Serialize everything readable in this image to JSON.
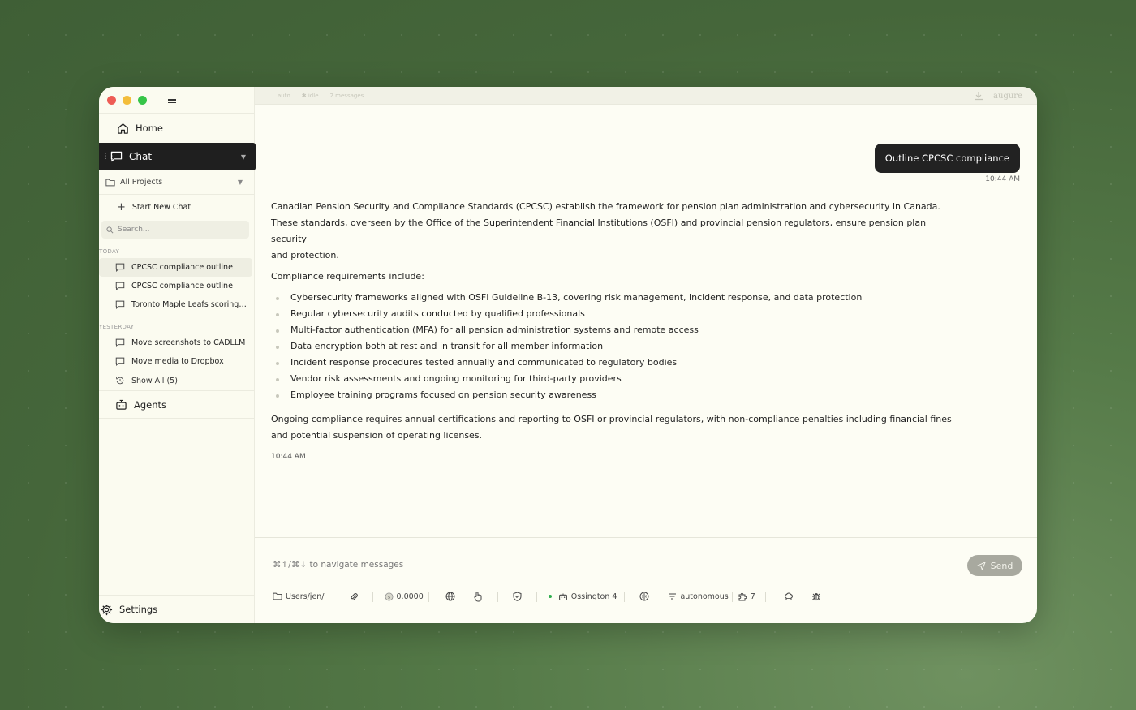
{
  "sidebar": {
    "home_label": "Home",
    "chat_label": "Chat",
    "projects_label": "All Projects",
    "new_chat_label": "Start New Chat",
    "search_placeholder": "Search...",
    "groups": [
      {
        "label": "TODAY",
        "items": [
          {
            "label": "CPCSC compliance outline",
            "active": true
          },
          {
            "label": "CPCSC compliance outline",
            "active": false
          },
          {
            "label": "Toronto Maple Leafs scoring l...",
            "active": false
          }
        ]
      },
      {
        "label": "YESTERDAY",
        "items": [
          {
            "label": "Move screenshots to CADLLM",
            "active": false
          },
          {
            "label": "Move media to Dropbox",
            "active": false
          }
        ]
      }
    ],
    "show_all_label": "Show All (5)",
    "agents_label": "Agents",
    "settings_label": "Settings"
  },
  "topbar": {
    "mode": "auto",
    "status": "idle",
    "message_count": "2 messages",
    "brand": "augure"
  },
  "conversation": {
    "user_message": "Outline CPCSC compliance",
    "user_time": "10:44 AM",
    "intro_line1": "Canadian Pension Security and Compliance Standards (CPCSC) establish the framework for pension plan administration and cybersecurity in Canada.",
    "intro_line2": "These standards, overseen by the Office of the Superintendent Financial Institutions (OSFI) and provincial pension regulators, ensure pension plan security",
    "intro_line3": "and protection.",
    "req_heading": "Compliance requirements include:",
    "requirements": [
      "Cybersecurity frameworks aligned with OSFI Guideline B-13, covering risk management, incident response, and data protection",
      "Regular cybersecurity audits conducted by qualified professionals",
      "Multi-factor authentication (MFA) for all pension administration systems and remote access",
      "Data encryption both at rest and in transit for all member information",
      "Incident response procedures tested annually and communicated to regulatory bodies",
      "Vendor risk assessments and ongoing monitoring for third-party providers",
      "Employee training programs focused on pension security awareness"
    ],
    "closing_line1": "Ongoing compliance requires annual certifications and reporting to OSFI or provincial regulators, with non-compliance penalties including financial fines",
    "closing_line2": "and potential suspension of operating licenses.",
    "answer_time": "10:44 AM"
  },
  "composer": {
    "hint": "⌘↑/⌘↓ to navigate messages",
    "send_label": "Send",
    "path": "Users/jen/",
    "cost": "0.0000",
    "model": "Ossington 4",
    "mode": "autonomous",
    "tools_count": "7"
  },
  "colors": {
    "accent_dark": "#1f1f1f",
    "status_green": "#2eae4d",
    "background_green": "#557a48"
  }
}
